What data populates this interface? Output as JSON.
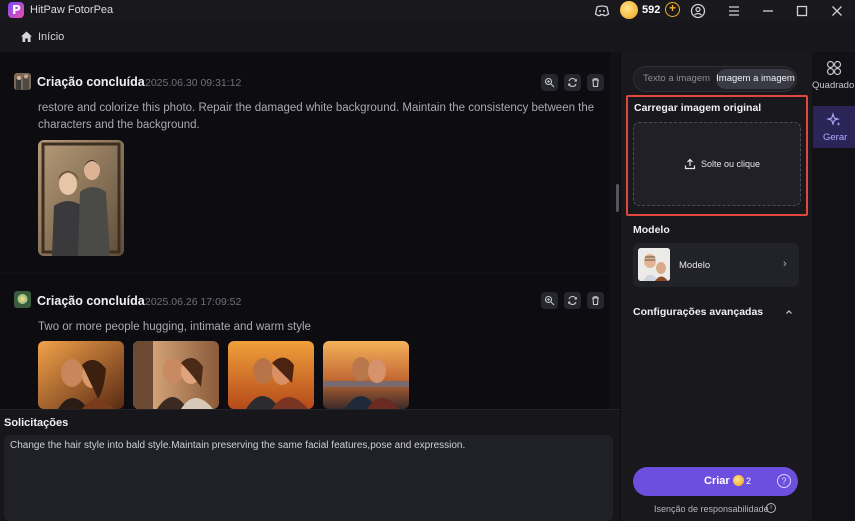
{
  "app": {
    "title": "HitPaw FotorPea",
    "coins": "592",
    "logo_letter": "P"
  },
  "nav": {
    "home_label": "Início"
  },
  "feed": {
    "cards": [
      {
        "title": "Criação concluída",
        "date": "2025.06.30   09:31:12",
        "prompt": "restore and colorize this photo. Repair the damaged white background. Maintain the consistency between the characters and the background."
      },
      {
        "title": "Criação concluída",
        "date": "2025.06.26   17:09:52",
        "prompt": "Two or more people hugging, intimate and warm style"
      }
    ]
  },
  "prompt_area": {
    "title": "Solicitações",
    "text": "Change the hair style into bald style.Maintain preserving the same facial features,pose and expression."
  },
  "panel": {
    "tabs": [
      "Texto a imagem",
      "Imagem a imagem"
    ],
    "active_tab": "Imagem a imagem",
    "upload_title": "Carregar imagem original",
    "upload_label": "Solte ou clique",
    "model_title": "Modelo",
    "model_label": "Modelo",
    "advanced_title": "Configurações avançadas",
    "create_label": "Criar",
    "create_cost": "2",
    "disclaimer": "Isenção de responsabilidade"
  },
  "rail": {
    "items": [
      {
        "label": "Quadrado",
        "icon": "grid-icon"
      },
      {
        "label": "Gerar",
        "icon": "sparkle-icon"
      }
    ]
  },
  "colors": {
    "accent": "#6d4fe0",
    "highlight_border": "#e0473d",
    "coin": "#f0a21b"
  }
}
